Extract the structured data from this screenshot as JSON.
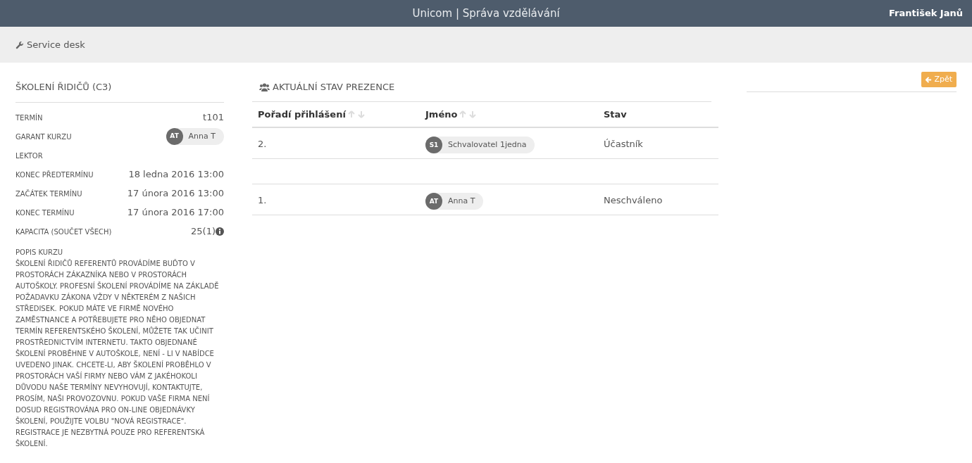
{
  "header": {
    "title": "Unicom | Správa vzdělávání",
    "user": "František Janů"
  },
  "breadcrumb": {
    "label": "Service desk"
  },
  "course": {
    "title": "ŠKOLENÍ ŘIDIČŮ (C3)",
    "details": [
      {
        "kind": "text",
        "label": "TERMÍN",
        "value": "t101"
      },
      {
        "kind": "person",
        "label": "GARANT KURZU",
        "initials": "AT",
        "value": "Anna T"
      },
      {
        "kind": "empty",
        "label": "LEKTOR"
      },
      {
        "kind": "text",
        "label": "KONEC PŘEDTERMÍNU",
        "value": "18 ledna 2016 13:00"
      },
      {
        "kind": "text",
        "label": "ZAČÁTEK TERMÍNU",
        "value": "17 února 2016 13:00"
      },
      {
        "kind": "text",
        "label": "KONEC TERMÍNU",
        "value": "17 února 2016 17:00"
      },
      {
        "kind": "info",
        "label": "KAPACITA (SOUČET VŠECH)",
        "value": "25(1)"
      }
    ],
    "description_label": "POPIS KURZU",
    "description": "ŠKOLENÍ ŘIDIČŮ REFERENTŮ PROVÁDÍME BUĎTO V PROSTORÁCH ZÁKAZNÍKA NEBO V PROSTORÁCH AUTOŠKOLY. PROFESNÍ ŠKOLENÍ PROVÁDÍME NA ZÁKLADĚ POŽADAVKU ZÁKONA VŽDY V NĚKTERÉM Z NAŠICH STŘEDISEK. POKUD MÁTE VE FIRMĚ NOVÉHO ZAMĚSTNANCE A POTŘEBUJETE PRO NĚHO OBJEDNAT TERMÍN REFERENTSKÉHO ŠKOLENÍ, MŮŽETE TAK UČINIT PROSTŘEDNICTVÍM INTERNETU. TAKTO OBJEDNANÉ ŠKOLENÍ PROBĚHNE V AUTOŠKOLE, NENÍ - LI V NABÍDCE UVEDENO JINAK. CHCETE-LI, ABY ŠKOLENÍ PROBĚHLO V PROSTORÁCH VAŠÍ FIRMY NEBO VÁM Z JAKÉHOKOLI DŮVODU NAŠE TERMÍNY NEVYHOVUJÍ, KONTAKTUJTE, PROSÍM, NAŠI PROVOZOVNU. POKUD VAŠE FIRMA NENÍ DOSUD REGISTROVÁNA PRO ON-LINE OBJEDNÁVKY ŠKOLENÍ, POUŽIJTE VOLBU \"NOVÁ REGISTRACE\". REGISTRACE JE NEZBYTNÁ POUZE PRO REFERENTSKÁ ŠKOLENÍ."
  },
  "attendance": {
    "title": "AKTUÁLNÍ STAV PREZENCE",
    "columns": [
      {
        "label": "Pořadí přihlášení",
        "sortable": true
      },
      {
        "label": "Jméno",
        "sortable": true
      },
      {
        "label": "Stav",
        "sortable": false
      }
    ],
    "groups": [
      [
        {
          "order": "2.",
          "initials": "S1",
          "name": "Schvalovatel 1jedna",
          "status": "Účastník"
        }
      ],
      [
        {
          "order": "1.",
          "initials": "AT",
          "name": "Anna T",
          "status": "Neschváleno"
        }
      ]
    ]
  },
  "back_button": {
    "label": "Zpět"
  }
}
